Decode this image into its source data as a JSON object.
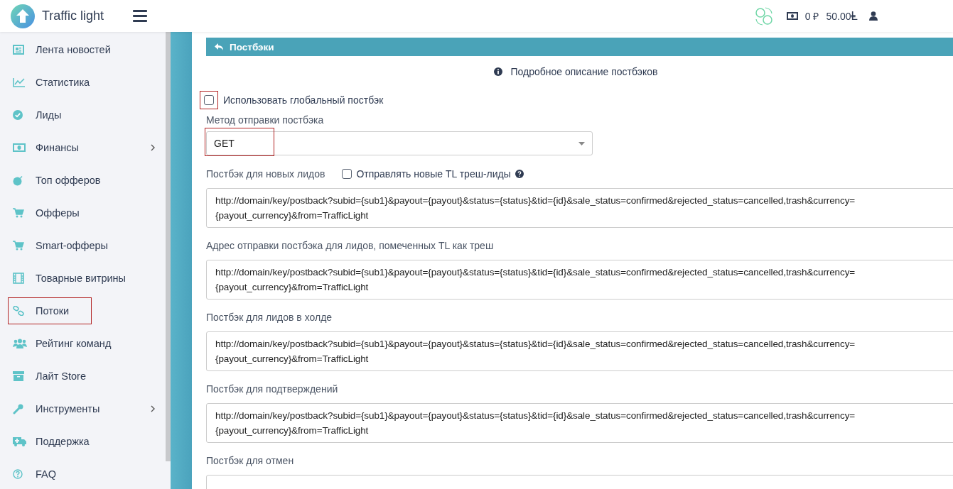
{
  "header": {
    "brand": "Traffic light",
    "balance_rub": "0 ₽",
    "balance_points": "50.00",
    "points_symbol": "Ⱡ"
  },
  "sidebar": {
    "items": [
      {
        "label": "Лента новостей",
        "has_submenu": false,
        "highlighted": false
      },
      {
        "label": "Статистика",
        "has_submenu": false,
        "highlighted": false
      },
      {
        "label": "Лиды",
        "has_submenu": false,
        "highlighted": false
      },
      {
        "label": "Финансы",
        "has_submenu": true,
        "highlighted": false
      },
      {
        "label": "Топ офферов",
        "has_submenu": false,
        "highlighted": false
      },
      {
        "label": "Офферы",
        "has_submenu": false,
        "highlighted": false
      },
      {
        "label": "Smart-офферы",
        "has_submenu": false,
        "highlighted": false
      },
      {
        "label": "Товарные витрины",
        "has_submenu": false,
        "highlighted": false
      },
      {
        "label": "Потоки",
        "has_submenu": false,
        "highlighted": true
      },
      {
        "label": "Рейтинг команд",
        "has_submenu": false,
        "highlighted": false
      },
      {
        "label": "Лайт Store",
        "has_submenu": false,
        "highlighted": false
      },
      {
        "label": "Инструменты",
        "has_submenu": true,
        "highlighted": false
      },
      {
        "label": "Поддержка",
        "has_submenu": false,
        "highlighted": false
      },
      {
        "label": "FAQ",
        "has_submenu": false,
        "highlighted": false
      }
    ]
  },
  "panel": {
    "title": "Постбэки",
    "info_link": "Подробное описание постбэков",
    "global_postback": {
      "label": "Использовать глобальный постбэк",
      "checked": false,
      "highlighted": true
    },
    "method": {
      "label": "Метод отправки постбэка",
      "value": "GET",
      "highlighted": true
    },
    "fields": [
      {
        "label": "Постбэк для новых лидов",
        "option": {
          "label": "Отправлять новые TL треш-лиды",
          "checked": false
        },
        "lines": [
          "http://domain/key/postback?subid={sub1}&payout={payout}&status={status}&tid={id}&sale_status=confirmed&rejected_status=cancelled,trash&currency=",
          "{payout_currency}&from=TrafficLight"
        ]
      },
      {
        "label": "Адрес отправки постбэка для лидов, помеченных TL как треш",
        "lines": [
          "http://domain/key/postback?subid={sub1}&payout={payout}&status={status}&tid={id}&sale_status=confirmed&rejected_status=cancelled,trash&currency=",
          "{payout_currency}&from=TrafficLight"
        ]
      },
      {
        "label": "Постбэк для лидов в холде",
        "lines": [
          "http://domain/key/postback?subid={sub1}&payout={payout}&status={status}&tid={id}&sale_status=confirmed&rejected_status=cancelled,trash&currency=",
          "{payout_currency}&from=TrafficLight"
        ]
      },
      {
        "label": "Постбэк для подтверждений",
        "lines": [
          "http://domain/key/postback?subid={sub1}&payout={payout}&status={status}&tid={id}&sale_status=confirmed&rejected_status=cancelled,trash&currency=",
          "{payout_currency}&from=TrafficLight"
        ]
      },
      {
        "label": "Постбэк для отмен"
      }
    ]
  }
}
